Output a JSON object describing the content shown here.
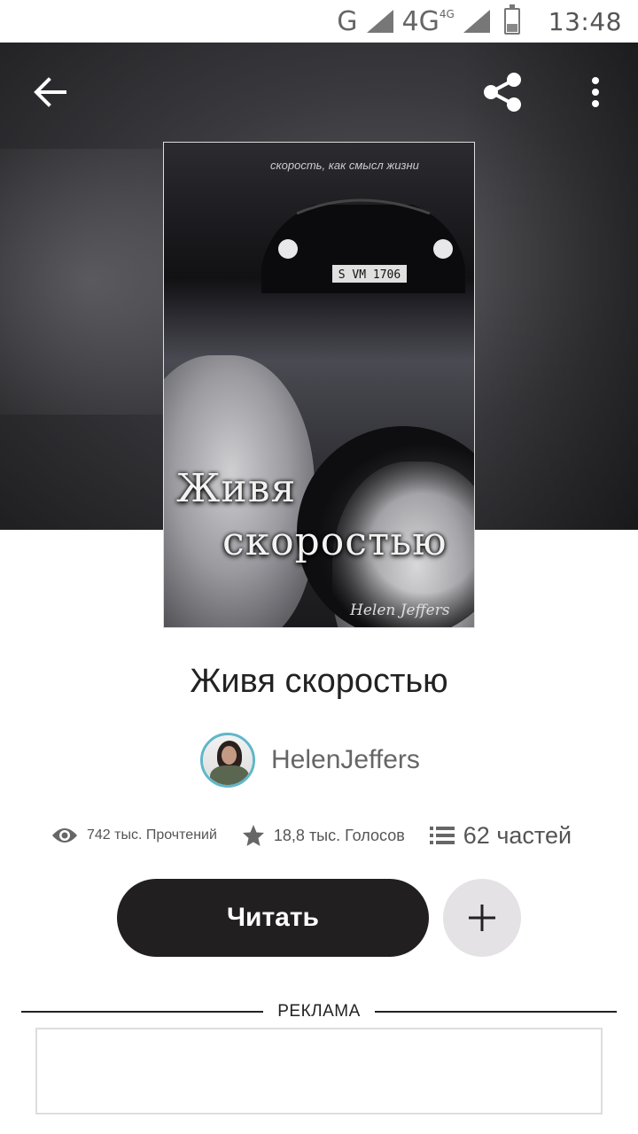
{
  "status_bar": {
    "network_g": "G",
    "network_4g": "4G",
    "network_4g_sup": "4G",
    "time": "13:48"
  },
  "toolbar": {
    "back_icon": "arrow-left-icon",
    "share_icon": "share-icon",
    "more_icon": "more-vertical-icon"
  },
  "cover": {
    "tagline": "скорость, как смысл жизни",
    "title_line1": "Живя",
    "title_line2": "скоростью",
    "author": "Helen Jeffers",
    "plate": "S VM 1706"
  },
  "book": {
    "title": "Живя скоростью",
    "author": "HelenJeffers"
  },
  "stats": {
    "reads": "742 тыс. Прочтений",
    "votes": "18,8 тыс. Голосов",
    "parts": "62 частей"
  },
  "actions": {
    "read_label": "Читать",
    "add_icon": "plus-icon"
  },
  "ad": {
    "label": "РЕКЛАМА"
  },
  "colors": {
    "read_button_bg": "#221f20",
    "add_button_bg": "#e4e2e4",
    "avatar_ring": "#5fb7c8"
  }
}
